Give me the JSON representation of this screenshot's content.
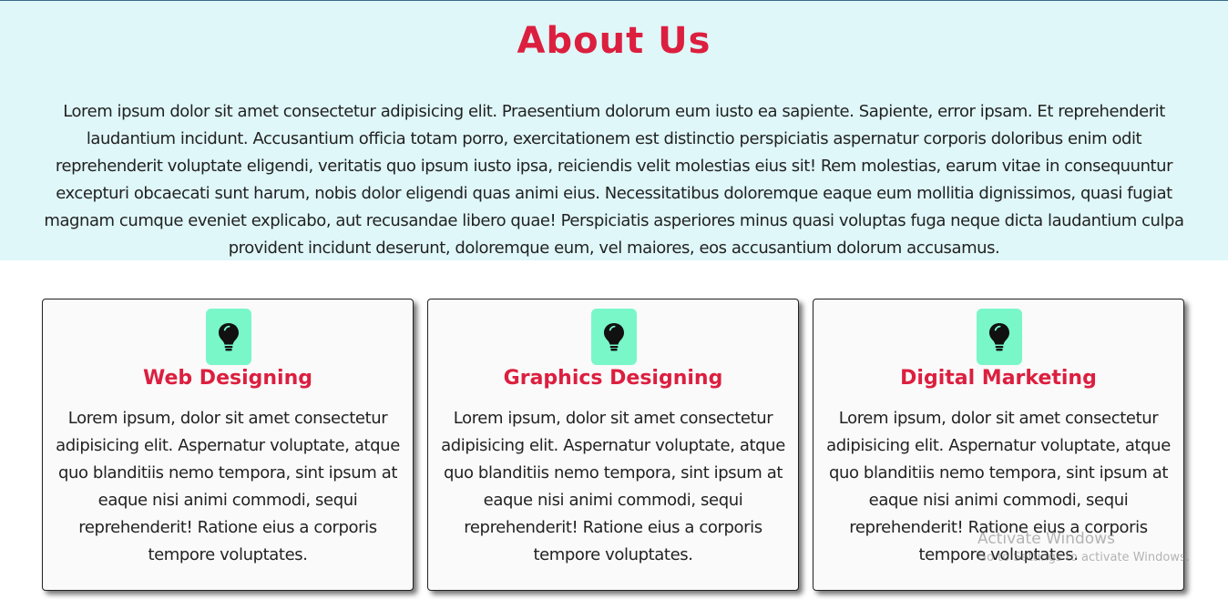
{
  "about": {
    "title": "About Us",
    "text": "Lorem ipsum dolor sit amet consectetur adipisicing elit. Praesentium dolorum eum iusto ea sapiente. Sapiente, error ipsam. Et reprehenderit laudantium incidunt. Accusantium officia totam porro, exercitationem est distinctio perspiciatis aspernatur corporis doloribus enim odit reprehenderit voluptate eligendi, veritatis quo ipsum iusto ipsa, reiciendis velit molestias eius sit! Rem molestias, earum vitae in consequuntur excepturi obcaecati sunt harum, nobis dolor eligendi quas animi eius. Necessitatibus doloremque eaque eum mollitia dignissimos, quasi fugiat magnam cumque eveniet explicabo, aut recusandae libero quae! Perspiciatis asperiores minus quasi voluptas fuga neque dicta laudantium culpa provident incidunt deserunt, doloremque eum, vel maiores, eos accusantium dolorum accusamus."
  },
  "services": [
    {
      "icon": "lightbulb-icon",
      "title": "Web Designing",
      "text": "Lorem ipsum, dolor sit amet consectetur adipisicing elit. Aspernatur voluptate, atque quo blanditiis nemo tempora, sint ipsum at eaque nisi animi commodi, sequi reprehenderit! Ratione eius a corporis tempore voluptates."
    },
    {
      "icon": "lightbulb-icon",
      "title": "Graphics Designing",
      "text": "Lorem ipsum, dolor sit amet consectetur adipisicing elit. Aspernatur voluptate, atque quo blanditiis nemo tempora, sint ipsum at eaque nisi animi commodi, sequi reprehenderit! Ratione eius a corporis tempore voluptates."
    },
    {
      "icon": "lightbulb-icon",
      "title": "Digital Marketing",
      "text": "Lorem ipsum, dolor sit amet consectetur adipisicing elit. Aspernatur voluptate, atque quo blanditiis nemo tempora, sint ipsum at eaque nisi animi commodi, sequi reprehenderit! Ratione eius a corporis tempore voluptates."
    }
  ],
  "watermark": {
    "title": "Activate Windows",
    "subtitle": "Go to Settings to activate Windows."
  },
  "colors": {
    "accent": "#dc1f3f",
    "about_background": "#dff7f9",
    "icon_background": "#79f7c9",
    "card_background": "#fafafa",
    "text": "#222222"
  }
}
